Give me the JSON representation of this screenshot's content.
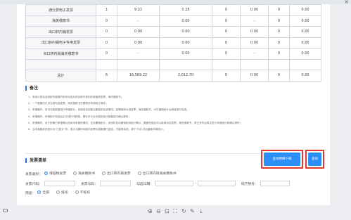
{
  "window": {
    "close_glyph": "×"
  },
  "table": {
    "rows": [
      {
        "name": "通行费电子发票",
        "count": "1",
        "amount": "9.22",
        "tax": "0.28",
        "c4": "0",
        "c5": "0.00",
        "c6": "0",
        "c7": "0.00"
      },
      {
        "name": "海关缴款书",
        "count": "0",
        "amount": "-",
        "tax": "0.00",
        "c4": "0",
        "c5": "-",
        "c6": "0",
        "c7": "0.00"
      },
      {
        "name": "出口转内销发票",
        "count": "0",
        "amount": "0.00",
        "tax": "0.00",
        "c4": "0",
        "c5": "0.00",
        "c6": "0",
        "c7": "0.00"
      },
      {
        "name": "出口转内销电子专用发票",
        "count": "0",
        "amount": "0.00",
        "tax": "0.00",
        "c4": "0",
        "c5": "0.00",
        "c6": "0",
        "c7": "0.00"
      },
      {
        "name": "出口转内销海关缴款书",
        "count": "0",
        "amount": "-",
        "tax": "0.00",
        "c4": "0",
        "c5": "-",
        "c6": "0",
        "c7": "0.00"
      },
      {
        "name": "",
        "count": "",
        "amount": "",
        "tax": "",
        "c4": "",
        "c5": "",
        "c6": "",
        "c7": ""
      },
      {
        "name": "总计",
        "count": "6",
        "amount": "16,589.22",
        "tax": "2,012.70",
        "c4": "0",
        "c5": "0.00",
        "c6": "0",
        "c7": "0.00"
      }
    ]
  },
  "notes": {
    "title": "备注",
    "items": [
      {
        "num": "1、",
        "text": "本统计表包含税款所属期内所有勾选为抵扣和不抵扣的增值税发票、海关缴款书；"
      },
      {
        "num": "2、",
        "text": "一个属期内只对当前勾选发票、海关缴款书无需再次申请统计操作；"
      },
      {
        "num": "3、",
        "text": "申报期内，对已勾选数据进行申请统计，系统将自动按当期抵扣勾选操作；如需继续勾选发票、海关缴款书，可在撤销统计后继续进行勾选；"
      },
      {
        "num": "4、",
        "text": "申报期内，申请统计完成后正式进行申报前，需在本平台对抵扣统计数据进行确认操作；"
      },
      {
        "num": "5、",
        "text": "申报期内，对于前期已申报确认但尚未申报的情况，支持撤销统计，系统将自动撤销抵扣统计确认，撤销完成后可以继续勾选发票、海关缴款书，修正完毕后再次进行申请统计和确认操作；"
      },
      {
        "num": "6、",
        "text": "当本属期状态显示为“已统计”时，表示当期时间段内发票勾选数据已锁定，不能再勾选，请于下月1日后重新申请统计。"
      }
    ]
  },
  "query": {
    "title": "发票清单",
    "btn_download": "查询明细下载",
    "btn_query": "查询",
    "type_label": "发票类别：",
    "type_options": [
      {
        "label": "增值税发票",
        "selected": true
      },
      {
        "label": "海关缴款书",
        "selected": false
      },
      {
        "label": "出口转内销发票",
        "selected": false
      },
      {
        "label": "出口转内销海关缴款书",
        "selected": false
      }
    ],
    "code_label": "发票代码：",
    "number_label": "发票号码：",
    "date_label": "勾选日期：",
    "date_sep": "-",
    "taxid_label": "销方税号：",
    "use_label": "用途：",
    "use_options": [
      {
        "label": "全部",
        "selected": true
      },
      {
        "label": "抵扣",
        "selected": false
      },
      {
        "label": "不抵扣",
        "selected": false
      }
    ]
  },
  "toolbar": {
    "zoom_in": "⊕",
    "zoom_out": "⊖",
    "fit": "⊡",
    "crop": "⛶",
    "rotate": "↻",
    "edit": "✎",
    "download": "⤓"
  }
}
